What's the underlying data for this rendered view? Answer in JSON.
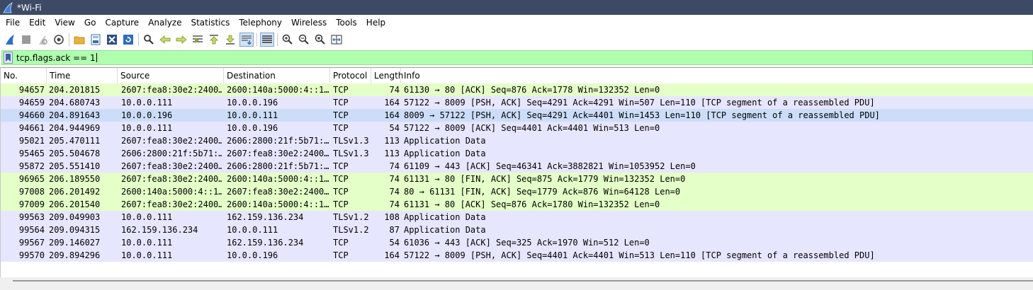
{
  "window": {
    "title": "*Wi-Fi"
  },
  "menu": [
    {
      "label": "File"
    },
    {
      "label": "Edit"
    },
    {
      "label": "View"
    },
    {
      "label": "Go"
    },
    {
      "label": "Capture"
    },
    {
      "label": "Analyze"
    },
    {
      "label": "Statistics"
    },
    {
      "label": "Telephony"
    },
    {
      "label": "Wireless"
    },
    {
      "label": "Tools"
    },
    {
      "label": "Help"
    }
  ],
  "toolbar_icons": [
    "start-capture-icon",
    "stop-capture-icon",
    "restart-capture-icon",
    "capture-options-icon",
    "open-file-icon",
    "save-file-icon",
    "close-file-icon",
    "reload-file-icon",
    "find-packet-icon",
    "go-back-icon",
    "go-forward-icon",
    "go-to-packet-icon",
    "go-first-icon",
    "go-last-icon",
    "auto-scroll-icon",
    "colorize-icon",
    "zoom-in-icon",
    "zoom-out-icon",
    "zoom-normal-icon",
    "resize-columns-icon"
  ],
  "filter": {
    "value": "tcp.flags.ack == 1"
  },
  "columns": [
    "No.",
    "Time",
    "Source",
    "Destination",
    "Protocol",
    "Length",
    "Info"
  ],
  "colors": {
    "green": "#e4ffc7",
    "blue": "#e7e6ff",
    "selected": "#ccddf9",
    "filter_bg": "#afffaf"
  },
  "packets": [
    {
      "no": "94657",
      "time": "204.201815",
      "src": "2607:fea8:30e2:2400…",
      "dst": "2600:140a:5000:4::1…",
      "proto": "TCP",
      "len": "74",
      "info": "61130 → 80 [ACK] Seq=876 Ack=1778 Win=132352 Len=0",
      "color": "green"
    },
    {
      "no": "94659",
      "time": "204.680743",
      "src": "10.0.0.111",
      "dst": "10.0.0.196",
      "proto": "TCP",
      "len": "164",
      "info": "57122 → 8009 [PSH, ACK] Seq=4291 Ack=4291 Win=507 Len=110 [TCP segment of a reassembled PDU]",
      "color": "blue"
    },
    {
      "no": "94660",
      "time": "204.891643",
      "src": "10.0.0.196",
      "dst": "10.0.0.111",
      "proto": "TCP",
      "len": "164",
      "info": "8009 → 57122 [PSH, ACK] Seq=4291 Ack=4401 Win=1453 Len=110 [TCP segment of a reassembled PDU]",
      "color": "selected"
    },
    {
      "no": "94661",
      "time": "204.944969",
      "src": "10.0.0.111",
      "dst": "10.0.0.196",
      "proto": "TCP",
      "len": "54",
      "info": "57122 → 8009 [ACK] Seq=4401 Ack=4401 Win=513 Len=0",
      "color": "blue"
    },
    {
      "no": "95021",
      "time": "205.470111",
      "src": "2607:fea8:30e2:2400…",
      "dst": "2606:2800:21f:5b71:…",
      "proto": "TLSv1.3",
      "len": "113",
      "info": "Application Data",
      "color": "blue"
    },
    {
      "no": "95465",
      "time": "205.504678",
      "src": "2606:2800:21f:5b71:…",
      "dst": "2607:fea8:30e2:2400…",
      "proto": "TLSv1.3",
      "len": "113",
      "info": "Application Data",
      "color": "blue"
    },
    {
      "no": "95872",
      "time": "205.551410",
      "src": "2607:fea8:30e2:2400…",
      "dst": "2606:2800:21f:5b71:…",
      "proto": "TCP",
      "len": "74",
      "info": "61109 → 443 [ACK] Seq=46341 Ack=3882821 Win=1053952 Len=0",
      "color": "blue"
    },
    {
      "no": "96965",
      "time": "206.189550",
      "src": "2607:fea8:30e2:2400…",
      "dst": "2600:140a:5000:4::1…",
      "proto": "TCP",
      "len": "74",
      "info": "61131 → 80 [FIN, ACK] Seq=875 Ack=1779 Win=132352 Len=0",
      "color": "green"
    },
    {
      "no": "97008",
      "time": "206.201492",
      "src": "2600:140a:5000:4::1…",
      "dst": "2607:fea8:30e2:2400…",
      "proto": "TCP",
      "len": "74",
      "info": "80 → 61131 [FIN, ACK] Seq=1779 Ack=876 Win=64128 Len=0",
      "color": "green"
    },
    {
      "no": "97009",
      "time": "206.201540",
      "src": "2607:fea8:30e2:2400…",
      "dst": "2600:140a:5000:4::1…",
      "proto": "TCP",
      "len": "74",
      "info": "61131 → 80 [ACK] Seq=876 Ack=1780 Win=132352 Len=0",
      "color": "green"
    },
    {
      "no": "99563",
      "time": "209.049903",
      "src": "10.0.0.111",
      "dst": "162.159.136.234",
      "proto": "TLSv1.2",
      "len": "108",
      "info": "Application Data",
      "color": "blue"
    },
    {
      "no": "99564",
      "time": "209.094315",
      "src": "162.159.136.234",
      "dst": "10.0.0.111",
      "proto": "TLSv1.2",
      "len": "87",
      "info": "Application Data",
      "color": "blue"
    },
    {
      "no": "99567",
      "time": "209.146027",
      "src": "10.0.0.111",
      "dst": "162.159.136.234",
      "proto": "TCP",
      "len": "54",
      "info": "61036 → 443 [ACK] Seq=325 Ack=1970 Win=512 Len=0",
      "color": "blue"
    },
    {
      "no": "99570",
      "time": "209.894296",
      "src": "10.0.0.111",
      "dst": "10.0.0.196",
      "proto": "TCP",
      "len": "164",
      "info": "57122 → 8009 [PSH, ACK] Seq=4401 Ack=4401 Win=513 Len=110 [TCP segment of a reassembled PDU]",
      "color": "blue"
    }
  ]
}
